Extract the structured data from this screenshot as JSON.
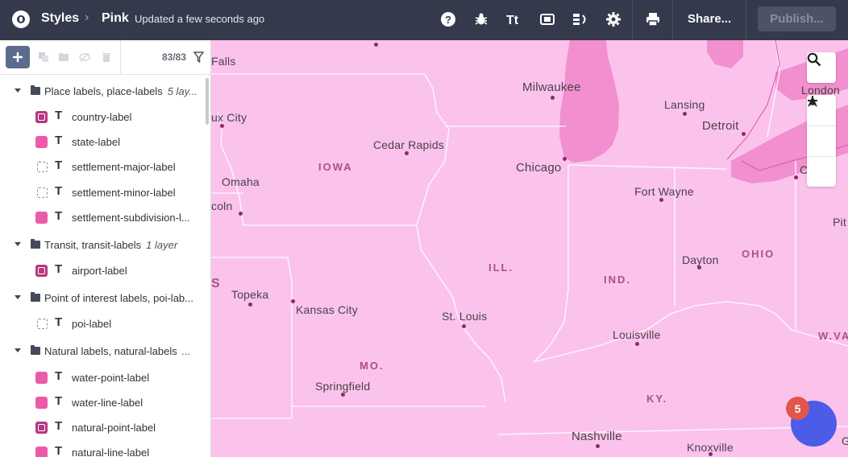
{
  "topbar": {
    "app_label": "Styles",
    "style_name": "Pink",
    "status": "Updated a few seconds ago",
    "share_label": "Share...",
    "publish_label": "Publish...",
    "icons": [
      "help-icon",
      "bug-icon",
      "typography-icon",
      "image-icon",
      "layout-icon",
      "settings-icon",
      "print-icon"
    ]
  },
  "sidebar": {
    "layer_count": "83/83",
    "groups": [
      {
        "name": "Place labels, place-labels",
        "count": "5 lay...",
        "layers": [
          {
            "name": "country-label",
            "swatch": "icon"
          },
          {
            "name": "state-label",
            "swatch": "fill"
          },
          {
            "name": "settlement-major-label",
            "swatch": "ghost"
          },
          {
            "name": "settlement-minor-label",
            "swatch": "ghost"
          },
          {
            "name": "settlement-subdivision-l...",
            "swatch": "fill"
          }
        ]
      },
      {
        "name": "Transit, transit-labels",
        "count": "1 layer",
        "layers": [
          {
            "name": "airport-label",
            "swatch": "icon"
          }
        ]
      },
      {
        "name": "Point of interest labels, poi-lab...",
        "count": "",
        "layers": [
          {
            "name": "poi-label",
            "swatch": "ghost"
          }
        ]
      },
      {
        "name": "Natural labels, natural-labels",
        "count": "...",
        "layers": [
          {
            "name": "water-point-label",
            "swatch": "fill"
          },
          {
            "name": "water-line-label",
            "swatch": "fill"
          },
          {
            "name": "natural-point-label",
            "swatch": "icon"
          },
          {
            "name": "natural-line-label",
            "swatch": "fill"
          }
        ]
      }
    ]
  },
  "map": {
    "cities": [
      "Falls",
      "ux City",
      "Cedar Rapids",
      "Milwaukee",
      "Lansing",
      "London",
      "Detroit",
      "Omaha",
      "Chicago",
      "Fort Wayne",
      "Cl",
      "Pit",
      "coln",
      "Dayton",
      "Topeka",
      "Kansas City",
      "St. Louis",
      "Louisville",
      "Springfield",
      "Nashville",
      "Knoxville",
      "G"
    ],
    "states": [
      "IOWA",
      "ILL.",
      "IND.",
      "OHIO",
      "S",
      "MO.",
      "KY.",
      "W.VA"
    ],
    "notification_count": "5"
  },
  "colors": {
    "topbar": "#34394b",
    "map_land": "#fbc3ec",
    "water": "#f18fcf",
    "accent": "#4b5de8",
    "badge": "#e0564b"
  }
}
